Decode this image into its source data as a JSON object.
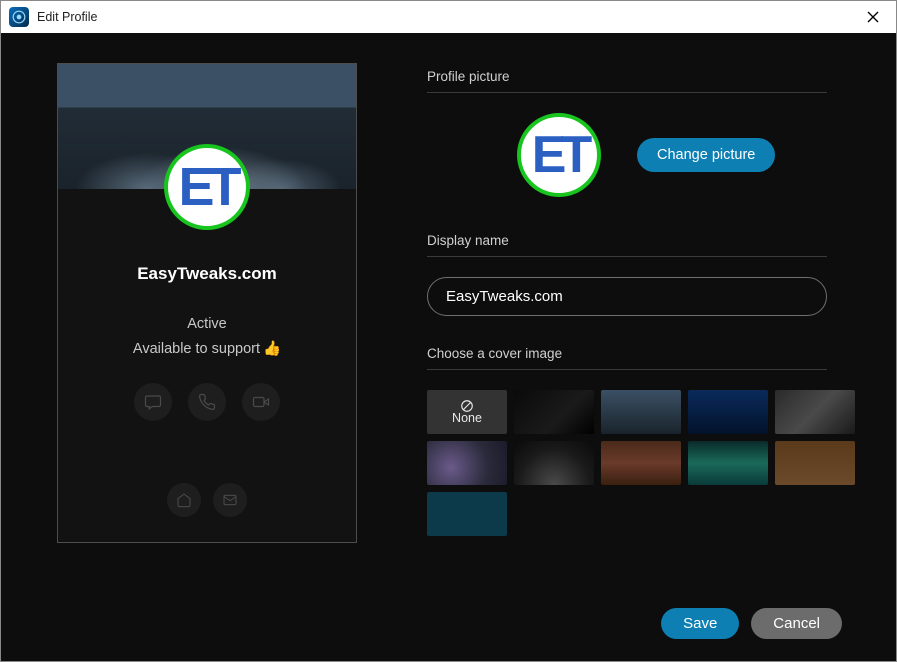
{
  "window": {
    "title": "Edit Profile"
  },
  "preview": {
    "display_name": "EasyTweaks.com",
    "status": "Active",
    "availability": "Available to support",
    "avatar_text": "ET"
  },
  "form": {
    "profile_picture_label": "Profile picture",
    "change_picture_label": "Change picture",
    "display_name_label": "Display name",
    "display_name_value": "EasyTweaks.com",
    "cover_label": "Choose a cover image",
    "cover_options": {
      "none_label": "None"
    },
    "avatar_text": "ET"
  },
  "buttons": {
    "save": "Save",
    "cancel": "Cancel"
  }
}
